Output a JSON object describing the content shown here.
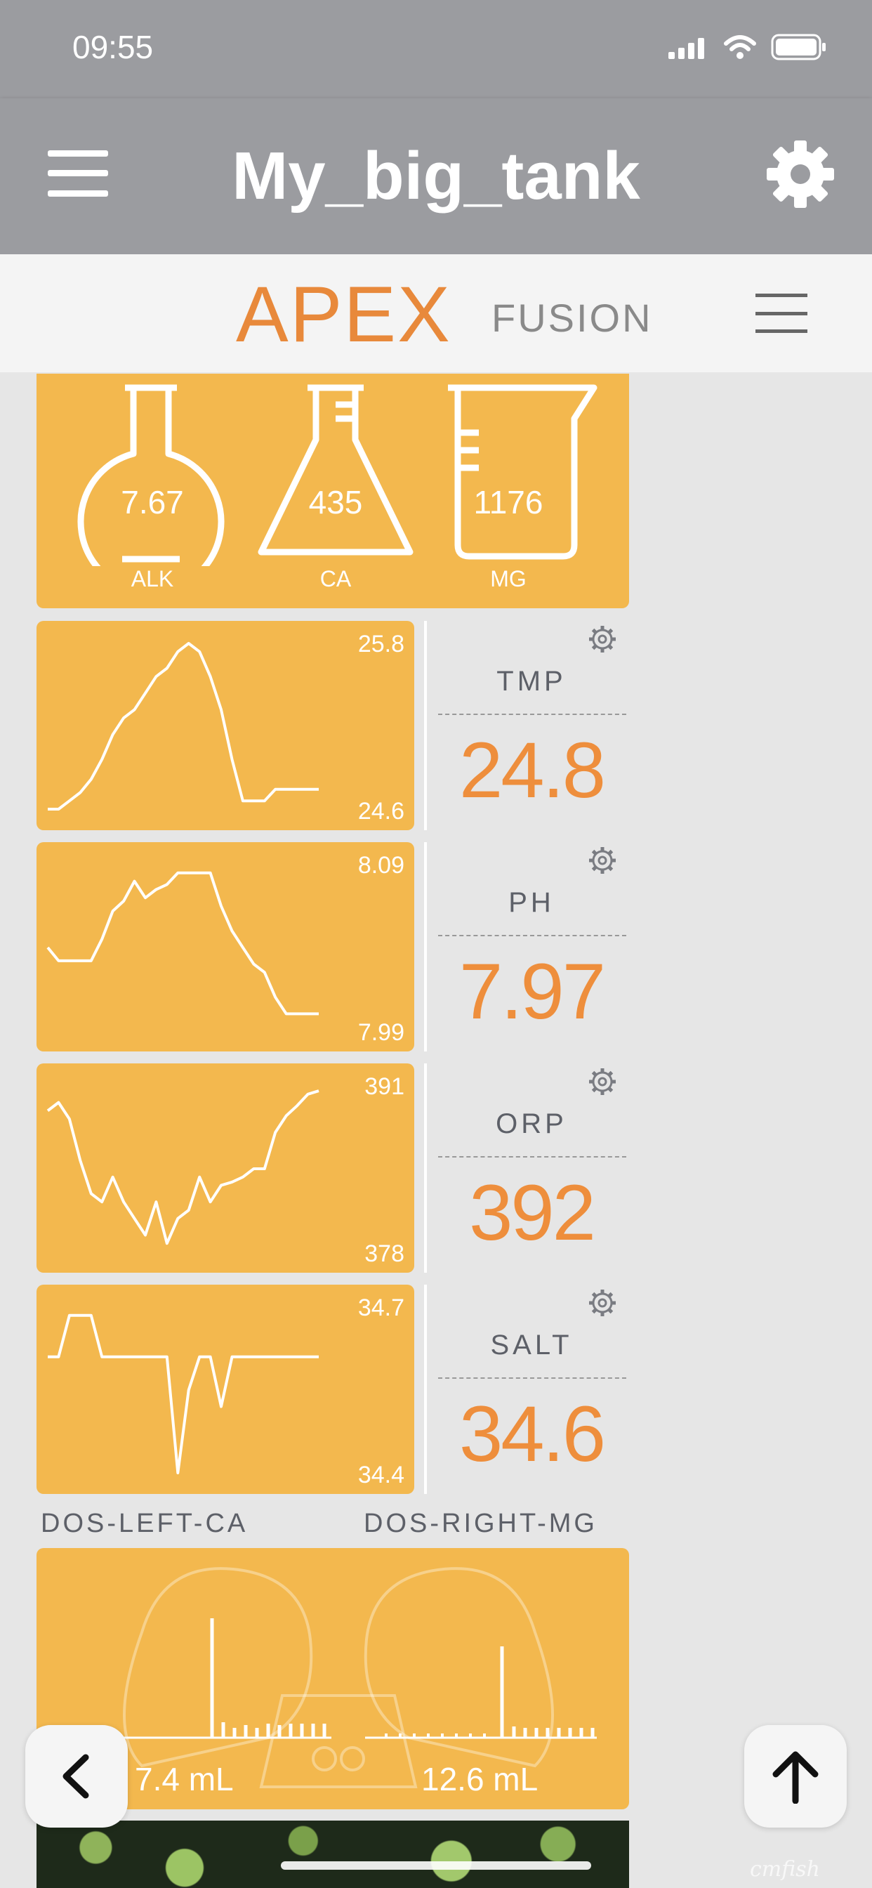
{
  "status": {
    "time": "09:55"
  },
  "header": {
    "title": "My_big_tank",
    "menu_icon": "hamburger-icon",
    "settings_icon": "gear-icon"
  },
  "apex": {
    "logo_main": "APEX",
    "logo_sub": "FUSION",
    "menu_icon": "hamburger-icon"
  },
  "flasks": [
    {
      "label": "ALK",
      "value": "7.67",
      "icon": "round-flask-icon"
    },
    {
      "label": "CA",
      "value": "435",
      "icon": "erlenmeyer-flask-icon"
    },
    {
      "label": "MG",
      "value": "1176",
      "icon": "beaker-icon"
    }
  ],
  "probes": [
    {
      "label": "TMP",
      "value": "24.8",
      "max": "25.8",
      "min": "24.6",
      "trend": [
        0.0,
        0.0,
        0.05,
        0.1,
        0.18,
        0.3,
        0.45,
        0.55,
        0.6,
        0.7,
        0.8,
        0.85,
        0.95,
        1.0,
        0.95,
        0.8,
        0.6,
        0.3,
        0.05,
        0.05,
        0.05,
        0.12,
        0.12,
        0.12,
        0.12,
        0.12
      ]
    },
    {
      "label": "PH",
      "value": "7.97",
      "max": "8.09",
      "min": "7.99",
      "trend": [
        0.5,
        0.42,
        0.42,
        0.42,
        0.42,
        0.55,
        0.72,
        0.78,
        0.9,
        0.8,
        0.85,
        0.88,
        0.95,
        0.95,
        0.95,
        0.95,
        0.75,
        0.6,
        0.5,
        0.4,
        0.35,
        0.2,
        0.1,
        0.1,
        0.1,
        0.1
      ]
    },
    {
      "label": "ORP",
      "value": "392",
      "max": "391",
      "min": "378",
      "trend": [
        0.85,
        0.9,
        0.8,
        0.55,
        0.35,
        0.3,
        0.45,
        0.3,
        0.2,
        0.1,
        0.3,
        0.05,
        0.2,
        0.25,
        0.45,
        0.3,
        0.4,
        0.42,
        0.45,
        0.5,
        0.5,
        0.72,
        0.82,
        0.88,
        0.95,
        0.97
      ]
    },
    {
      "label": "SALT",
      "value": "34.6",
      "max": "34.7",
      "min": "34.4",
      "trend": [
        0.7,
        0.7,
        0.95,
        0.95,
        0.95,
        0.7,
        0.7,
        0.7,
        0.7,
        0.7,
        0.7,
        0.7,
        0.0,
        0.5,
        0.7,
        0.7,
        0.4,
        0.7,
        0.7,
        0.7,
        0.7,
        0.7,
        0.7,
        0.7,
        0.7,
        0.7
      ]
    }
  ],
  "dosing": {
    "left": {
      "label": "DOS-LEFT-CA",
      "value": "7.4 mL"
    },
    "right": {
      "label": "DOS-RIGHT-MG",
      "value": "12.6 mL"
    }
  },
  "fab": {
    "back_icon": "chevron-left-icon",
    "up_icon": "arrow-up-icon"
  },
  "watermark": "cmfish"
}
